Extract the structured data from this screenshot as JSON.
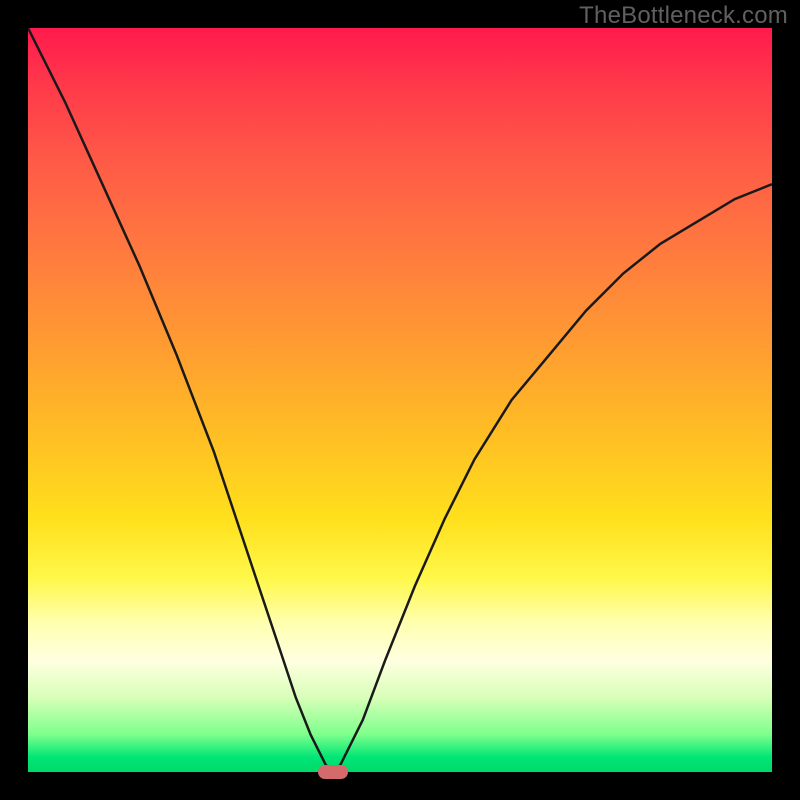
{
  "watermark": "TheBottleneck.com",
  "colors": {
    "frame": "#000000",
    "curve": "#1a1a1a",
    "marker": "#d46a6a",
    "gradient_top": "#ff1a4d",
    "gradient_bottom": "#00d968"
  },
  "chart_data": {
    "type": "line",
    "title": "",
    "xlabel": "",
    "ylabel": "",
    "xlim": [
      0,
      100
    ],
    "ylim": [
      0,
      100
    ],
    "series": [
      {
        "name": "bottleneck-curve",
        "x": [
          0,
          5,
          10,
          15,
          20,
          25,
          28,
          31,
          34,
          36,
          38,
          40,
          41,
          42,
          45,
          48,
          52,
          56,
          60,
          65,
          70,
          75,
          80,
          85,
          90,
          95,
          100
        ],
        "values": [
          100,
          90,
          79,
          68,
          56,
          43,
          34,
          25,
          16,
          10,
          5,
          1,
          0,
          1,
          7,
          15,
          25,
          34,
          42,
          50,
          56,
          62,
          67,
          71,
          74,
          77,
          79
        ]
      }
    ],
    "marker": {
      "x": 41,
      "y": 0
    },
    "gradient_stops": [
      {
        "pos": 0,
        "color": "#ff1a4d"
      },
      {
        "pos": 30,
        "color": "#ff7a3f"
      },
      {
        "pos": 66,
        "color": "#ffe01c"
      },
      {
        "pos": 85,
        "color": "#ffffe0"
      },
      {
        "pos": 100,
        "color": "#00d968"
      }
    ]
  }
}
